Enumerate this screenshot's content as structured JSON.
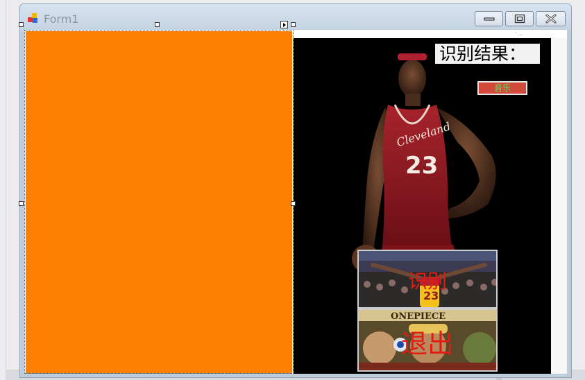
{
  "window": {
    "title": "Form1",
    "minimize_icon": "minimize-icon",
    "maximize_icon": "maximize-icon",
    "close_icon": "close-icon"
  },
  "result_label": {
    "text": "识别结果："
  },
  "music_button": {
    "label": "音乐"
  },
  "identify_button": {
    "label": "识别",
    "image": "basketball-crowd-photo"
  },
  "exit_button": {
    "label": "退出",
    "image": "one-piece-poster"
  },
  "corner_logo": {
    "text": "' ..."
  },
  "colors": {
    "left_panel": "#ff7f00",
    "image_panel": "#000000",
    "button_text": "#e31b12",
    "music_text": "#5ce35c",
    "music_bg": "#d24a3c"
  }
}
